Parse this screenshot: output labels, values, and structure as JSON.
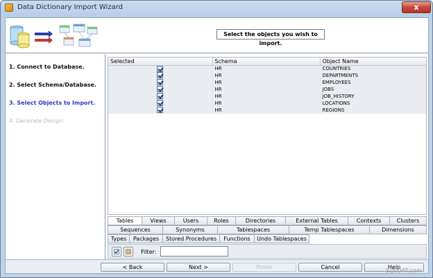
{
  "window": {
    "title": "Data Dictionary Import Wizard",
    "close_glyph": "x"
  },
  "header": {
    "instruction": "Select the objects you wish to import."
  },
  "steps": [
    {
      "label": "1. Connect to Database.",
      "state": "done"
    },
    {
      "label": "2. Select Schema/Database.",
      "state": "done"
    },
    {
      "label": "3. Select Objects to Import.",
      "state": "current"
    },
    {
      "label": "4. Generate Design.",
      "state": "future"
    }
  ],
  "grid": {
    "columns": [
      "Selected",
      "Schema",
      "Object Name"
    ],
    "rows": [
      {
        "selected": true,
        "schema": "HR",
        "object": "COUNTRIES"
      },
      {
        "selected": true,
        "schema": "HR",
        "object": "DEPARTMENTS"
      },
      {
        "selected": true,
        "schema": "HR",
        "object": "EMPLOYEES"
      },
      {
        "selected": true,
        "schema": "HR",
        "object": "JOBS"
      },
      {
        "selected": true,
        "schema": "HR",
        "object": "JOB_HISTORY"
      },
      {
        "selected": true,
        "schema": "HR",
        "object": "LOCATIONS"
      },
      {
        "selected": true,
        "schema": "HR",
        "object": "REGIONS"
      }
    ]
  },
  "tabs": {
    "row1": [
      "Tables",
      "Views",
      "Users",
      "Roles",
      "Directories",
      "External Tables",
      "Contexts",
      "Clusters"
    ],
    "row2": [
      "Sequences",
      "Synonyms",
      "Tablespaces",
      "Temp Tablespaces",
      "Dimensions"
    ],
    "row3": [
      "Types",
      "Packages",
      "Stored Procedures",
      "Functions",
      "Undo Tablespaces"
    ],
    "active": "Tables"
  },
  "filter": {
    "label": "Filter:",
    "value": ""
  },
  "footer": {
    "back": "< Back",
    "next": "Next >",
    "finish": "Finish",
    "cancel": "Cancel",
    "help": "Help"
  },
  "watermark": "SQLDAT.com",
  "icons": {
    "select_all": "select-all-icon",
    "deselect_all": "deselect-all-icon"
  }
}
